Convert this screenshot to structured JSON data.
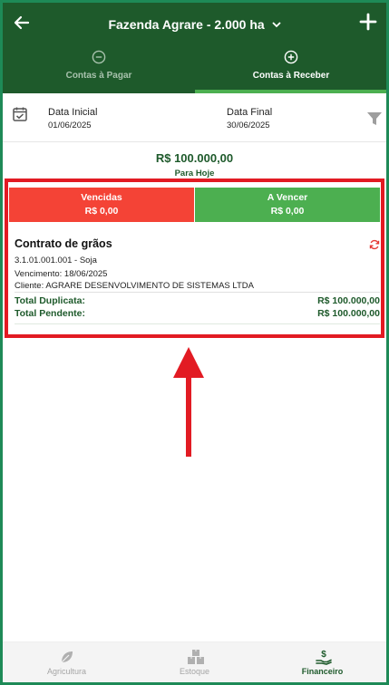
{
  "header": {
    "farm_name": "Fazenda Agrare - 2.000 ha",
    "back_icon": "arrow-left-icon",
    "add_icon": "plus-icon",
    "tabs": [
      {
        "label": "Contas à Pagar",
        "icon": "minus-circle-icon",
        "active": false
      },
      {
        "label": "Contas à Receber",
        "icon": "plus-circle-icon",
        "active": true
      }
    ],
    "colors": {
      "header_bg": "#1e5a2b",
      "tab_indicator": "#4caf50"
    }
  },
  "filters": {
    "data_inicial_label": "Data Inicial",
    "data_inicial_value": "01/06/2025",
    "data_final_label": "Data Final",
    "data_final_value": "30/06/2025",
    "calendar_icon": "calendar-check-icon",
    "filter_icon": "funnel-icon"
  },
  "summary": {
    "total": "R$ 100.000,00",
    "caption": "Para Hoje"
  },
  "status": {
    "vencidas_label": "Vencidas",
    "vencidas_value": "R$ 0,00",
    "avencer_label": "A Vencer",
    "avencer_value": "R$ 0,00",
    "colors": {
      "vencidas": "#f44336",
      "avencer": "#4caf50"
    }
  },
  "contract": {
    "title": "Contrato de grãos",
    "code": "3.1.01.001.001 - Soja",
    "vencimento": "Vencimento: 18/06/2025",
    "cliente": "Cliente: AGRARE DESENVOLVIMENTO DE SISTEMAS LTDA",
    "total_duplicata_label": "Total Duplicata:",
    "total_duplicata_value": "R$ 100.000,00",
    "total_pendente_label": "Total Pendente:",
    "total_pendente_value": "R$ 100.000,00",
    "sync_icon": "sync-icon"
  },
  "annotation": {
    "highlight_color": "#e21b23",
    "arrow_icon": "arrow-up-icon"
  },
  "bottom_nav": {
    "items": [
      {
        "label": "Agricultura",
        "icon": "leaf-icon",
        "active": false
      },
      {
        "label": "Estoque",
        "icon": "boxes-icon",
        "active": false
      },
      {
        "label": "Financeiro",
        "icon": "money-hand-icon",
        "active": true
      }
    ]
  }
}
